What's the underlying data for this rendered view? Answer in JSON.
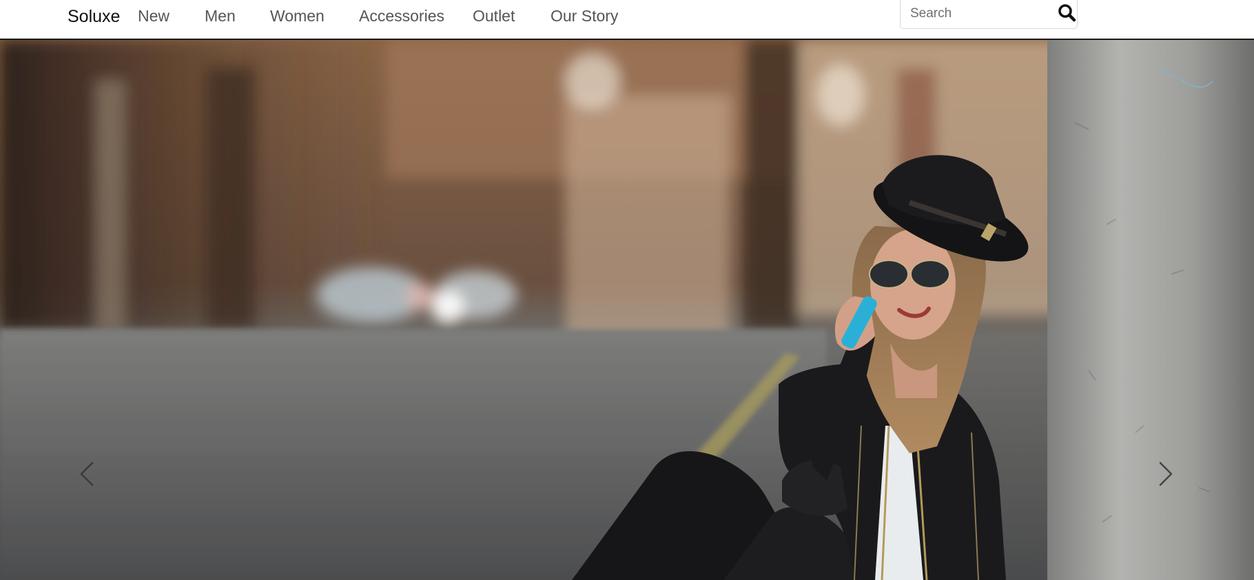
{
  "brand": {
    "name": "Soluxe"
  },
  "nav": {
    "items": [
      {
        "label": "New"
      },
      {
        "label": "Men"
      },
      {
        "label": "Women"
      },
      {
        "label": "Accessories"
      },
      {
        "label": "Outlet"
      },
      {
        "label": "Our Story"
      }
    ]
  },
  "search": {
    "placeholder": "Search",
    "value": "",
    "icon": "magnifier-icon"
  },
  "hero": {
    "image": "woman in hat and sunglasses on phone sitting by street pole",
    "controls": {
      "prev_icon": "chevron-left-icon",
      "next_icon": "chevron-right-icon"
    }
  },
  "colors": {
    "navbar_bg": "#ffffff",
    "navbar_border": "#1a1a1a",
    "brand_text": "#111111",
    "nav_text": "#555555"
  }
}
